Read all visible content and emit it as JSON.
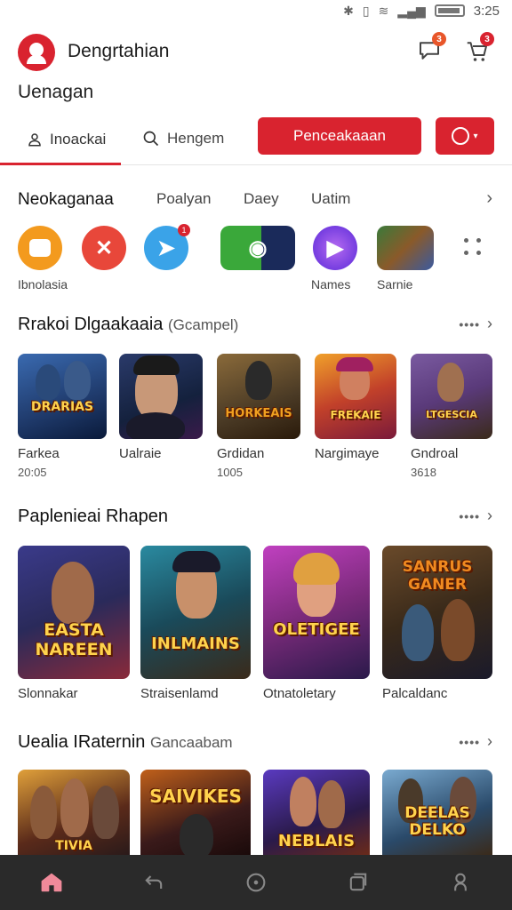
{
  "status_bar": {
    "time": "3:25"
  },
  "header": {
    "title": "Dengrtahian",
    "notif_count": "3",
    "cart_count": "3"
  },
  "subtitle": "Uenagan",
  "search_row": {
    "tab_primary": "Inoackai",
    "tab_secondary": "Hengem",
    "primary_button": "Penceakaaan"
  },
  "categories": [
    "Neokaganaa",
    "Poalyan",
    "Daey",
    "Uatim"
  ],
  "apps": [
    {
      "label": "Ibnolasia",
      "color": "#f39a1e",
      "icon": "chat-bubble-icon"
    },
    {
      "label": "",
      "color": "#e8473a",
      "icon": "close-icon"
    },
    {
      "label": "",
      "color": "#3aa3e8",
      "icon": "telegram-icon",
      "badge": "1"
    },
    {
      "label": "",
      "color": "#3aa83a",
      "icon": "game-pad-icon"
    },
    {
      "label": "Names",
      "color": "#7a3ad9",
      "icon": "play-icon"
    },
    {
      "label": "Sarnie",
      "color": "#8a5a2a",
      "icon": "game-tile-icon"
    }
  ],
  "section1": {
    "title": "Rrakoi Dlgaakaaia",
    "subtitle": "(Gcampel)",
    "items": [
      {
        "name": "Farkea",
        "meta": "20:05",
        "art": "DRARIAS",
        "bg": "#1f3a6b"
      },
      {
        "name": "Ualraie",
        "meta": "",
        "art": "",
        "bg": "#14213d"
      },
      {
        "name": "Grdidan",
        "meta": "1005",
        "art": "HORKEAIS",
        "bg": "#4a3a25"
      },
      {
        "name": "Nargimaye",
        "meta": "",
        "art": "FREKAIE",
        "bg": "#c2412a"
      },
      {
        "name": "Gndroal",
        "meta": "3618",
        "art": "LTGESCIA",
        "bg": "#5a3a7a"
      }
    ]
  },
  "section2": {
    "title": "Paplenieai Rhapen",
    "items": [
      {
        "name": "Slonnakar",
        "art": "EASTA NAREEN",
        "bg": "#2a2a5a"
      },
      {
        "name": "Straisenlamd",
        "art": "INLMAINS",
        "bg": "#1a4a5a"
      },
      {
        "name": "Otnatoletary",
        "art": "OLETIGEE",
        "bg": "#7a2a7a"
      },
      {
        "name": "Palcaldanc",
        "art": "SANRUS GANER",
        "bg": "#3a2a1a"
      }
    ]
  },
  "section3": {
    "title": "Uealia IRaternin",
    "subtitle": "Gancaabam",
    "items": [
      {
        "name": "",
        "art": "TIVIA",
        "bg": "#5a2a1a"
      },
      {
        "name": "",
        "art": "SAIVIKES",
        "bg": "#3a1a1a"
      },
      {
        "name": "",
        "art": "NEBLAIS",
        "bg": "#2a1a4a"
      },
      {
        "name": "",
        "art": "DEELAS DELKO",
        "bg": "#2a4a6a"
      }
    ]
  },
  "colors": {
    "accent": "#d9232f"
  }
}
